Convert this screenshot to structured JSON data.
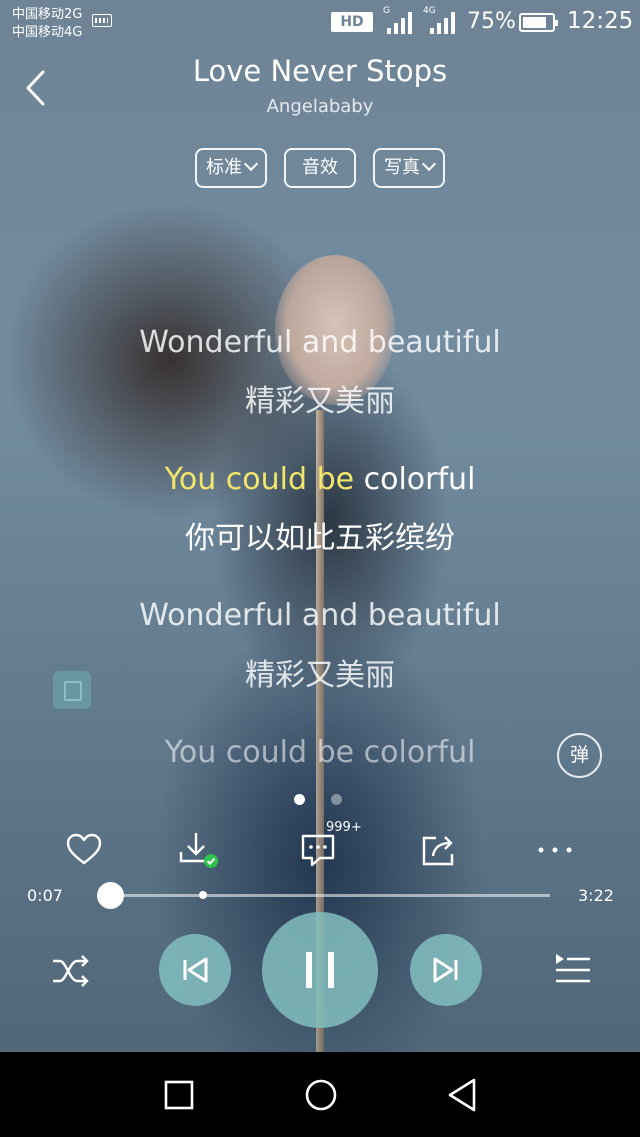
{
  "status_bar": {
    "carrier_1": "中国移动2G",
    "carrier_2": "中国移动4G",
    "hd": "HD",
    "network_1": "G",
    "network_2": "4G",
    "battery": "75%",
    "time": "12:25"
  },
  "header": {
    "back_icon": "chevron-left-icon",
    "title": "Love Never Stops",
    "artist": "Angelababy"
  },
  "options": {
    "quality": "标准",
    "sound_effect": "音效",
    "photo": "写真"
  },
  "lyrics": {
    "lines": [
      {
        "text": "Wonderful and beautiful",
        "state": "normal"
      },
      {
        "text": "精彩又美丽",
        "state": "normal"
      },
      {
        "sung": "You could be ",
        "unsung": "colorful",
        "state": "active"
      },
      {
        "text": "你可以如此五彩缤纷",
        "state": "active"
      },
      {
        "text": "Wonderful and beautiful",
        "state": "normal"
      },
      {
        "text": "精彩又美丽",
        "state": "normal"
      },
      {
        "text": "You could be colorful",
        "state": "dim"
      }
    ],
    "sung_color": "#f2e66c"
  },
  "danmu_label": "弹",
  "pager": {
    "pages": 2,
    "current": 1
  },
  "actions": {
    "like_icon": "heart-icon",
    "download_icon": "download-icon",
    "comment_icon": "comment-icon",
    "comment_count": "999+",
    "share_icon": "share-icon",
    "more_icon": "more-icon"
  },
  "progress": {
    "current": "0:07",
    "total": "3:22",
    "fraction": 0.035
  },
  "controls": {
    "shuffle_icon": "shuffle-icon",
    "previous_icon": "previous-icon",
    "pause_icon": "pause-icon",
    "next_icon": "next-icon",
    "playlist_icon": "playlist-icon"
  },
  "nav": {
    "recents_icon": "square-icon",
    "home_icon": "circle-icon",
    "back_icon": "triangle-back-icon"
  },
  "colors": {
    "accent": "#82bebe",
    "sung_lyric": "#f2e66c"
  }
}
